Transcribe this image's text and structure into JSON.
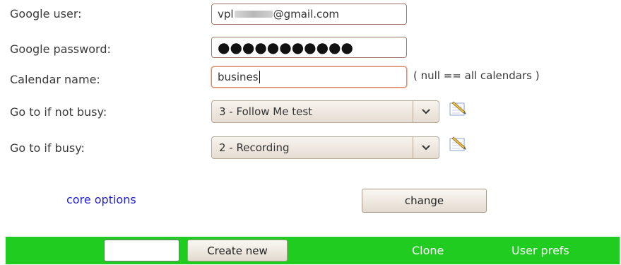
{
  "form": {
    "google_user": {
      "label": "Google user:",
      "value_prefix": "vpl",
      "value_suffix": "@gmail.com"
    },
    "google_password": {
      "label": "Google password:",
      "value": "●●●●●●●●●●●"
    },
    "calendar_name": {
      "label": "Calendar name:",
      "value": "busines",
      "hint": "( null == all calendars )"
    },
    "goto_not_busy": {
      "label": "Go to if not busy:",
      "selected": "3 - Follow Me test"
    },
    "goto_busy": {
      "label": "Go to if busy:",
      "selected": "2 - Recording"
    }
  },
  "actions": {
    "core_options": "core options",
    "change": "change"
  },
  "footer": {
    "create_new": "Create new",
    "clone": "Clone",
    "user_prefs": "User prefs"
  },
  "colors": {
    "footer_bg": "#1fcc1f",
    "link": "#2222cc"
  }
}
